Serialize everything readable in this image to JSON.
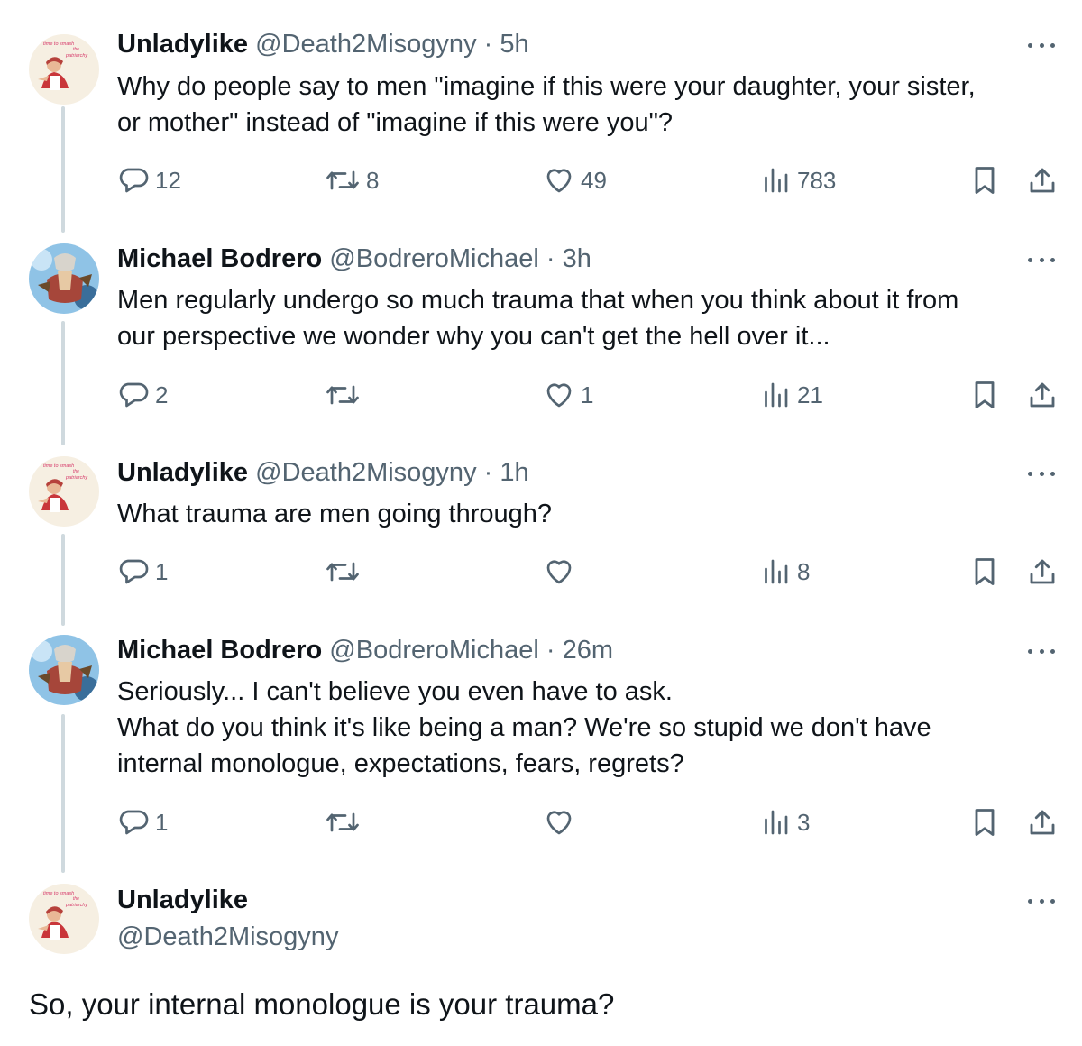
{
  "tweets": [
    {
      "name": "Unladylike",
      "handle": "@Death2Misogyny",
      "time": "· 5h",
      "text": "Why do people say to men \"imagine if this were your daughter, your sister,\nor mother\" instead of \"imagine if this were you\"?",
      "replies": "12",
      "reposts": "8",
      "likes": "49",
      "views": "783",
      "avatar": "unladylike-avatar"
    },
    {
      "name": "Michael Bodrero",
      "handle": "@BodreroMichael",
      "time": "· 3h",
      "text": "Men regularly undergo so much trauma that when you think about it from\nour perspective we wonder why you can't get the hell over it...",
      "replies": "2",
      "reposts": "",
      "likes": "1",
      "views": "21",
      "avatar": "michael-avatar"
    },
    {
      "name": "Unladylike",
      "handle": "@Death2Misogyny",
      "time": "· 1h",
      "text": "What trauma are men going through?",
      "replies": "1",
      "reposts": "",
      "likes": "",
      "views": "8",
      "avatar": "unladylike-avatar"
    },
    {
      "name": "Michael Bodrero",
      "handle": "@BodreroMichael",
      "time": "· 26m",
      "text": "Seriously... I can't believe you even have to ask.\nWhat do you think it's like being a man? We're so stupid we don't have\ninternal monologue, expectations, fears, regrets?",
      "replies": "1",
      "reposts": "",
      "likes": "",
      "views": "3",
      "avatar": "michael-avatar"
    }
  ],
  "main_tweet": {
    "name": "Unladylike",
    "handle": "@Death2Misogyny",
    "text": "So, your internal monologue is your trauma?"
  },
  "avatar_text": {
    "line1": "time to smash",
    "line2": "the",
    "line3": "patriarchy"
  },
  "icons": [
    "reply-icon",
    "repost-icon",
    "like-icon",
    "views-icon",
    "bookmark-icon",
    "share-icon",
    "more-icon"
  ],
  "colors": {
    "text": "#0f1419",
    "secondary": "#536471",
    "thread_line": "#cfd9de"
  }
}
